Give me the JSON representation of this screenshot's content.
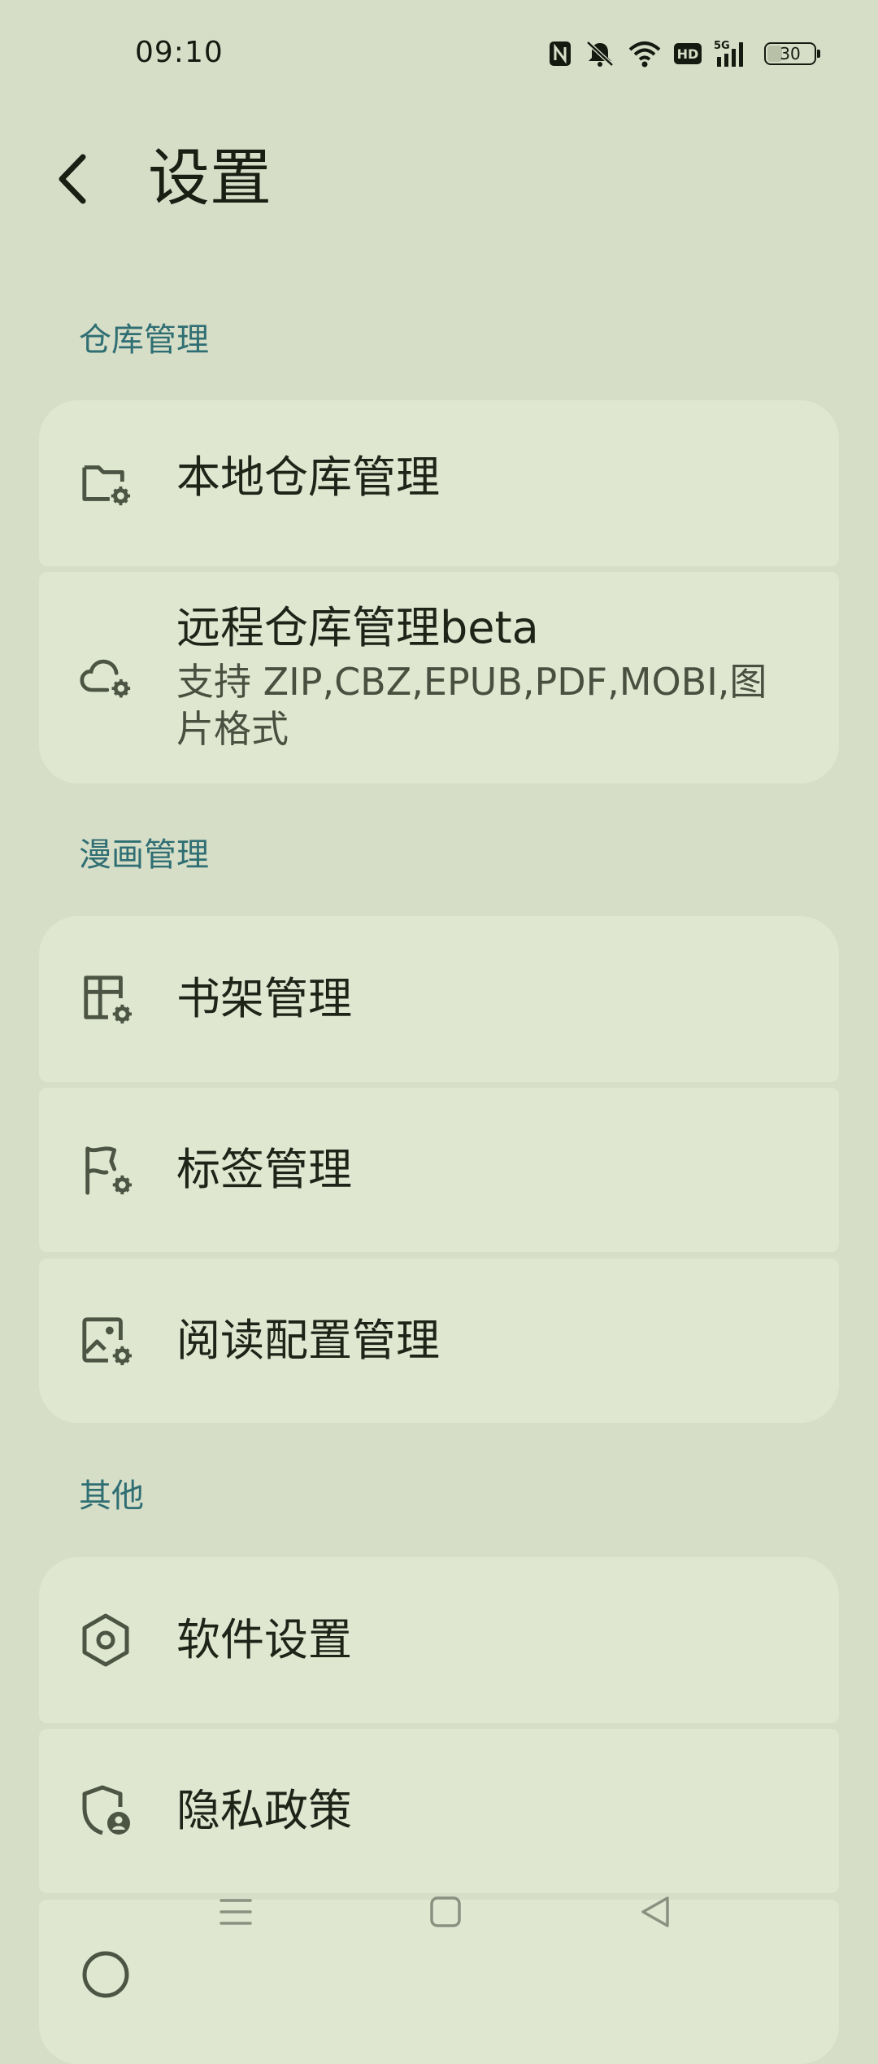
{
  "status_bar": {
    "time": "09:10",
    "network": "5G",
    "hd_badge": "HD",
    "battery_level": "30"
  },
  "header": {
    "title": "设置"
  },
  "sections": [
    {
      "header": "仓库管理",
      "items": [
        {
          "icon": "folder-settings-icon",
          "title": "本地仓库管理",
          "subtitle": ""
        },
        {
          "icon": "cloud-settings-icon",
          "title": "远程仓库管理beta",
          "subtitle": "支持 ZIP,CBZ,EPUB,PDF,MOBI,图片格式"
        }
      ]
    },
    {
      "header": "漫画管理",
      "items": [
        {
          "icon": "shelf-settings-icon",
          "title": "书架管理",
          "subtitle": ""
        },
        {
          "icon": "flag-settings-icon",
          "title": "标签管理",
          "subtitle": ""
        },
        {
          "icon": "image-settings-icon",
          "title": "阅读配置管理",
          "subtitle": ""
        }
      ]
    },
    {
      "header": "其他",
      "items": [
        {
          "icon": "hexagon-settings-icon",
          "title": "软件设置",
          "subtitle": ""
        },
        {
          "icon": "shield-user-icon",
          "title": "隐私政策",
          "subtitle": ""
        }
      ]
    }
  ],
  "colors": {
    "background": "#d7dec8",
    "card": "#e0e7d1",
    "section_header": "#2f6e73",
    "text": "#1f2418"
  }
}
